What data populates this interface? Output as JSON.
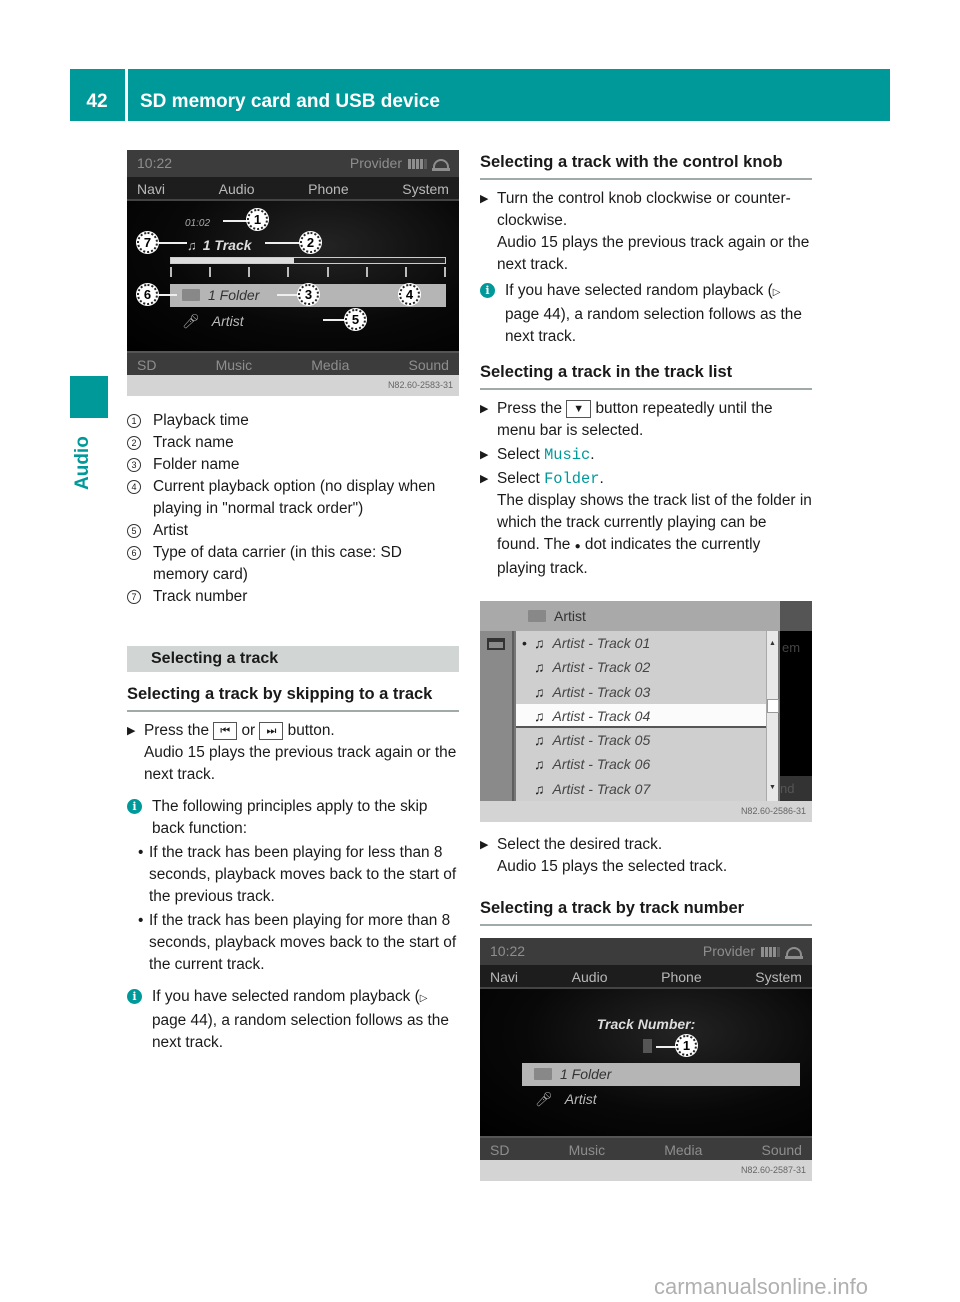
{
  "header": {
    "page_number": "42",
    "title": "SD memory card and USB device"
  },
  "side_tab": {
    "label": "Audio"
  },
  "screen1": {
    "time": "10:22",
    "provider": "Provider",
    "menu": [
      "Navi",
      "Audio",
      "Phone",
      "System"
    ],
    "playback_time": "01:02",
    "track": "1 Track",
    "folder": "1 Folder",
    "artist": "Artist",
    "progress_fraction": 0.45,
    "bottom_menu": [
      "SD",
      "Music",
      "Media",
      "Sound"
    ],
    "code": "N82.60-2583-31",
    "callouts": [
      "1",
      "2",
      "3",
      "4",
      "5",
      "6",
      "7"
    ]
  },
  "legend": [
    {
      "num": "1",
      "text": "Playback time"
    },
    {
      "num": "2",
      "text": "Track name"
    },
    {
      "num": "3",
      "text": "Folder name"
    },
    {
      "num": "4",
      "text": "Current playback option (no display when playing in \"normal track order\")"
    },
    {
      "num": "5",
      "text": "Artist"
    },
    {
      "num": "6",
      "text": "Type of data carrier (in this case: SD memory card)"
    },
    {
      "num": "7",
      "text": "Track number"
    }
  ],
  "section_selecting": {
    "title": "Selecting a track",
    "skip": {
      "heading": "Selecting a track by skipping to a track",
      "step_pre": "Press the",
      "key_prev": "⏮",
      "or": "or",
      "key_next": "⏭",
      "step_post": "button.",
      "result": "Audio 15 plays the previous track again or the next track.",
      "info1": "The following principles apply to the skip back function:",
      "bullets": [
        "If the track has been playing for less than 8 seconds, playback moves back to the start of the previous track.",
        "If the track has been playing for more than 8 seconds, playback moves back to the start of the current track."
      ],
      "info2_pre": "If you have selected random playback (",
      "info2_ref": "page 44",
      "info2_post": "), a random selection follows as the next track."
    },
    "knob": {
      "heading": "Selecting a track with the control knob",
      "step": "Turn the control knob clockwise or counter-clockwise.",
      "result": "Audio 15 plays the previous track again or the next track.",
      "info_pre": "If you have selected random playback (",
      "info_ref": "page 44",
      "info_post": "), a random selection follows as the next track."
    },
    "list": {
      "heading": "Selecting a track in the track list",
      "step1_pre": "Press the",
      "step1_key": "▼",
      "step1_post": "button repeatedly until the menu bar is selected.",
      "step2_pre": "Select",
      "step2_item": "Music",
      "step3_pre": "Select",
      "step3_item": "Folder",
      "step3_result_pre": "The display shows the track list of the folder in which the track currently playing can be found. The",
      "step3_result_dot": "●",
      "step3_result_post": "dot indicates the currently playing track.",
      "screen": {
        "header": "Artist",
        "right_fragment_top": "em",
        "right_fragment_bottom": "nd",
        "tracks": [
          "Artist - Track 01",
          "Artist - Track 02",
          "Artist - Track 03",
          "Artist - Track 04",
          "Artist - Track 05",
          "Artist - Track 06",
          "Artist - Track  07"
        ],
        "playing_index": 0,
        "selected_index": 3,
        "code": "N82.60-2586-31"
      },
      "step4": "Select the desired track.",
      "step4_result": "Audio 15 plays the selected track."
    },
    "number": {
      "heading": "Selecting a track by track number",
      "screen": {
        "time": "10:22",
        "provider": "Provider",
        "menu": [
          "Navi",
          "Audio",
          "Phone",
          "System"
        ],
        "label": "Track Number:",
        "folder": "1 Folder",
        "artist": "Artist",
        "bottom_menu": [
          "SD",
          "Music",
          "Media",
          "Sound"
        ],
        "code": "N82.60-2587-31",
        "callout": "1"
      }
    }
  },
  "watermark": "carmanualsonline.info"
}
